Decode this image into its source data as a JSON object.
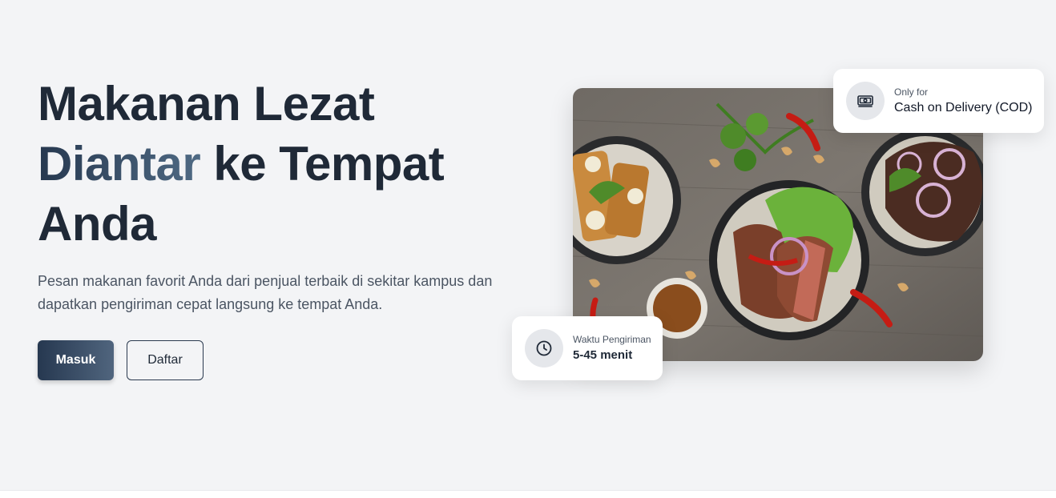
{
  "hero": {
    "title_line1": "Makanan Lezat",
    "title_accent": "Diantar",
    "title_line2_rest": " ke Tempat",
    "title_line3": "Anda",
    "description": "Pesan makanan favorit Anda dari penjual terbaik di sekitar kampus dan dapatkan pengiriman cepat langsung ke tempat Anda.",
    "login_label": "Masuk",
    "register_label": "Daftar"
  },
  "badges": {
    "payment": {
      "small": "Only for",
      "strong": "Cash on Delivery (COD)",
      "icon": "cash-icon"
    },
    "delivery": {
      "small": "Waktu Pengiriman",
      "strong": "5-45 menit",
      "icon": "clock-icon"
    }
  },
  "colors": {
    "background": "#f3f4f6",
    "heading": "#1f2937",
    "accent_start": "#263850",
    "accent_end": "#50657e"
  }
}
